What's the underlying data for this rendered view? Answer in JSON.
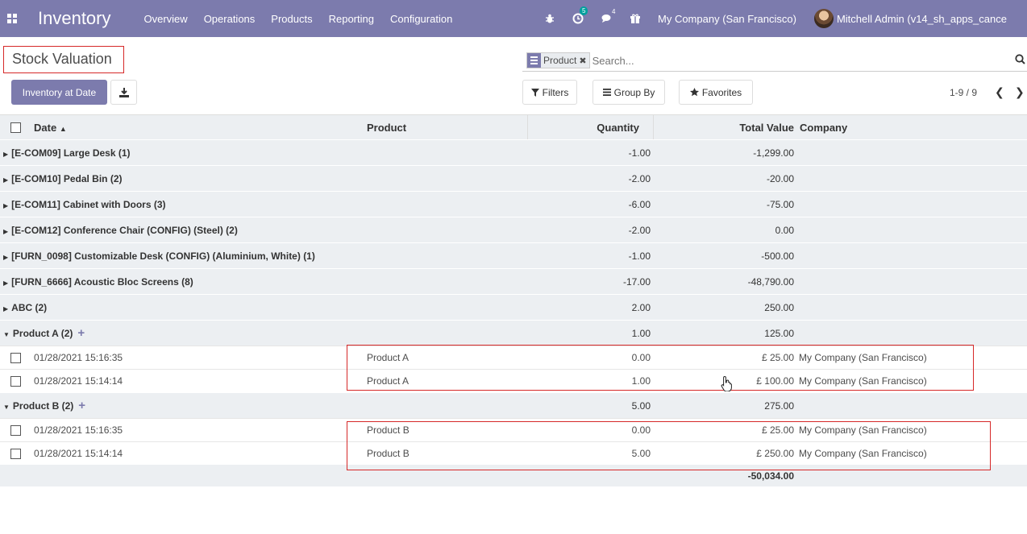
{
  "navbar": {
    "app_title": "Inventory",
    "menu": [
      "Overview",
      "Operations",
      "Products",
      "Reporting",
      "Configuration"
    ],
    "activity_count": "5",
    "message_count": "4",
    "company": "My Company (San Francisco)",
    "user": "Mitchell Admin (v14_sh_apps_cance"
  },
  "control_panel": {
    "title": "Stock Valuation",
    "inventory_at_date_label": "Inventory at Date",
    "search": {
      "facet_label": "Product",
      "placeholder": "Search..."
    },
    "filters_label": "Filters",
    "groupby_label": "Group By",
    "favorites_label": "Favorites",
    "pager_value": "1-9 / 9"
  },
  "table": {
    "columns": {
      "date": "Date",
      "product": "Product",
      "quantity": "Quantity",
      "total_value": "Total Value",
      "company": "Company"
    },
    "groups": [
      {
        "label": "[E-COM09] Large Desk (1)",
        "quantity": "-1.00",
        "value": "-1,299.00"
      },
      {
        "label": "[E-COM10] Pedal Bin (2)",
        "quantity": "-2.00",
        "value": "-20.00"
      },
      {
        "label": "[E-COM11] Cabinet with Doors (3)",
        "quantity": "-6.00",
        "value": "-75.00"
      },
      {
        "label": "[E-COM12] Conference Chair (CONFIG) (Steel) (2)",
        "quantity": "-2.00",
        "value": "0.00"
      },
      {
        "label": "[FURN_0098] Customizable Desk (CONFIG) (Aluminium, White) (1)",
        "quantity": "-1.00",
        "value": "-500.00"
      },
      {
        "label": "[FURN_6666] Acoustic Bloc Screens (8)",
        "quantity": "-17.00",
        "value": "-48,790.00"
      },
      {
        "label": "ABC (2)",
        "quantity": "2.00",
        "value": "250.00"
      }
    ],
    "product_a": {
      "label": "Product A (2)",
      "quantity": "1.00",
      "value": "125.00",
      "rows": [
        {
          "date": "01/28/2021 15:16:35",
          "product": "Product A",
          "quantity": "0.00",
          "value": "£ 25.00",
          "company": "My Company (San Francisco)"
        },
        {
          "date": "01/28/2021 15:14:14",
          "product": "Product A",
          "quantity": "1.00",
          "value": "£ 100.00",
          "company": "My Company (San Francisco)"
        }
      ]
    },
    "product_b": {
      "label": "Product B (2)",
      "quantity": "5.00",
      "value": "275.00",
      "rows": [
        {
          "date": "01/28/2021 15:16:35",
          "product": "Product B",
          "quantity": "0.00",
          "value": "£ 25.00",
          "company": "My Company (San Francisco)"
        },
        {
          "date": "01/28/2021 15:14:14",
          "product": "Product B",
          "quantity": "5.00",
          "value": "£ 250.00",
          "company": "My Company (San Francisco)"
        }
      ]
    },
    "total_value": "-50,034.00"
  },
  "colors": {
    "brand": "#7c7bad",
    "highlight": "#d62828",
    "group_bg": "#eceff2"
  }
}
